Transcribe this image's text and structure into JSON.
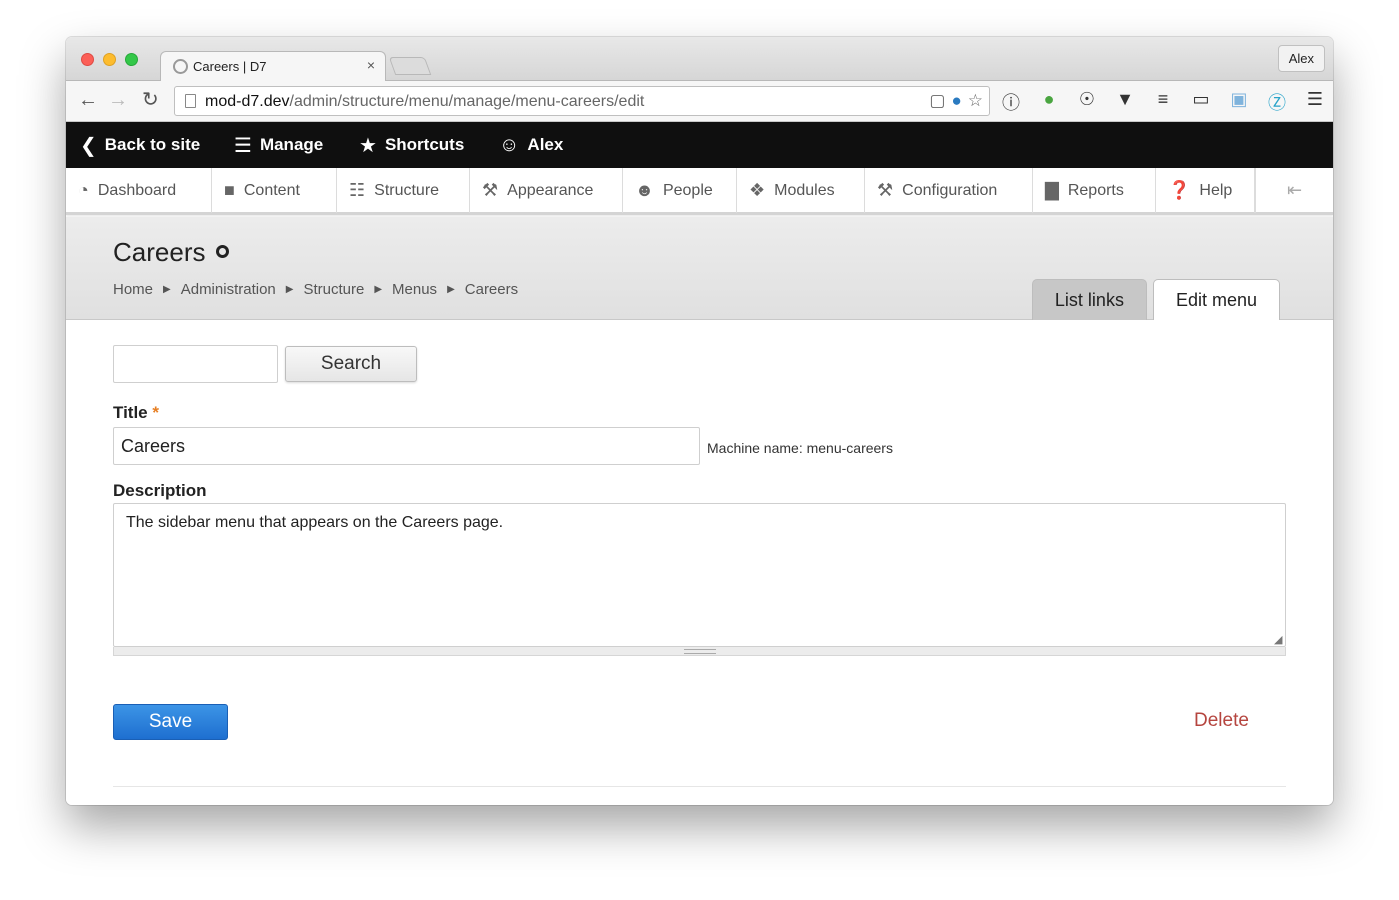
{
  "browser": {
    "tab_title": "Careers | D7",
    "tab_close": "×",
    "profile_name": "Alex",
    "url_host": "mod-d7.dev",
    "url_path": "/admin/structure/menu/manage/menu-careers/edit"
  },
  "admin_bar": {
    "back_label": "Back to site",
    "manage_label": "Manage",
    "shortcuts_label": "Shortcuts",
    "user_label": "Alex"
  },
  "tray": {
    "items": [
      {
        "label": "Dashboard",
        "icon": "dashboard-icon"
      },
      {
        "label": "Content",
        "icon": "content-icon"
      },
      {
        "label": "Structure",
        "icon": "structure-icon"
      },
      {
        "label": "Appearance",
        "icon": "appearance-icon"
      },
      {
        "label": "People",
        "icon": "people-icon"
      },
      {
        "label": "Modules",
        "icon": "modules-icon"
      },
      {
        "label": "Configuration",
        "icon": "configuration-icon"
      },
      {
        "label": "Reports",
        "icon": "reports-icon"
      },
      {
        "label": "Help",
        "icon": "help-icon"
      }
    ]
  },
  "header": {
    "page_title": "Careers",
    "breadcrumb": [
      "Home",
      "Administration",
      "Structure",
      "Menus",
      "Careers"
    ],
    "tabs": [
      {
        "label": "List links",
        "active": false
      },
      {
        "label": "Edit menu",
        "active": true
      }
    ]
  },
  "form": {
    "search_value": "",
    "search_button": "Search",
    "title_label": "Title",
    "required_mark": "*",
    "title_value": "Careers",
    "machine_name": "Machine name: menu-careers",
    "description_label": "Description",
    "description_value": "The sidebar menu that appears on the Careers page.",
    "save_button": "Save",
    "delete_link": "Delete"
  },
  "colors": {
    "admin_bar": "#0f0f0f",
    "save_button": "#2b7fdc",
    "delete_link": "#b5453f",
    "required": "#e67e22"
  }
}
